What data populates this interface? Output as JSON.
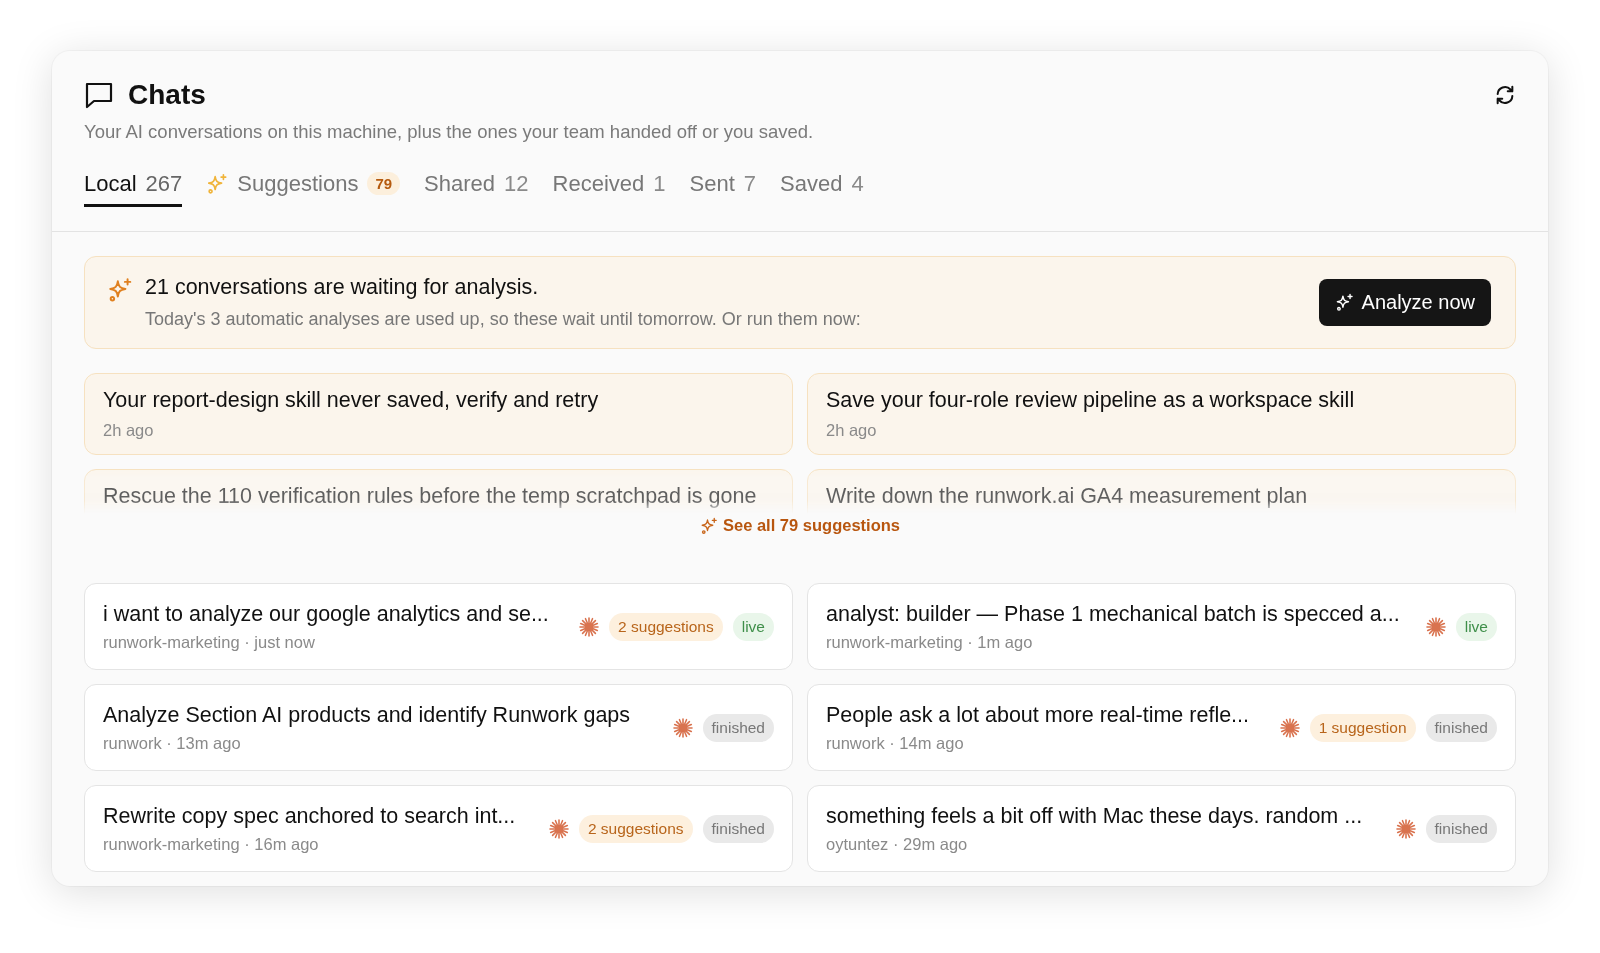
{
  "header": {
    "title": "Chats",
    "subtitle": "Your AI conversations on this machine, plus the ones your team handed off or you saved."
  },
  "tabs": [
    {
      "kind": "plain",
      "label": "Local",
      "count": "267",
      "selected": true
    },
    {
      "kind": "suggestions",
      "label": "Suggestions",
      "count": "79",
      "selected": false
    },
    {
      "kind": "plain",
      "label": "Shared",
      "count": "12",
      "selected": false
    },
    {
      "kind": "plain",
      "label": "Received",
      "count": "1",
      "selected": false
    },
    {
      "kind": "plain",
      "label": "Sent",
      "count": "7",
      "selected": false
    },
    {
      "kind": "plain",
      "label": "Saved",
      "count": "4",
      "selected": false
    }
  ],
  "banner": {
    "title": "21 conversations are waiting for analysis.",
    "text": "Today's 3 automatic analyses are used up, so these wait until tomorrow. Or run them now:",
    "button": "Analyze now"
  },
  "suggestions": [
    {
      "title": "Your report-design skill never saved, verify and retry",
      "time": "2h ago"
    },
    {
      "title": "Save your four-role review pipeline as a workspace skill",
      "time": "2h ago"
    },
    {
      "title": "Rescue the 110 verification rules before the temp scratchpad is gone"
    },
    {
      "title": "Write down the runwork.ai GA4 measurement plan"
    }
  ],
  "see_all": "See all 79 suggestions",
  "chats": [
    {
      "title": "i want to analyze our google analytics and se...",
      "meta": "runwork-marketing · just now",
      "suggestions": "2 suggestions",
      "status": "live"
    },
    {
      "title": "analyst: builder — Phase 1 mechanical batch is specced a...",
      "meta": "runwork-marketing · 1m ago",
      "status": "live"
    },
    {
      "title": "Analyze Section AI products and identify Runwork gaps",
      "meta": "runwork · 13m ago",
      "status": "finished"
    },
    {
      "title": "People ask a lot about more real-time refle...",
      "meta": "runwork · 14m ago",
      "suggestions": "1 suggestion",
      "status": "finished"
    },
    {
      "title": "Rewrite copy spec anchored to search int...",
      "meta": "runwork-marketing · 16m ago",
      "suggestions": "2 suggestions",
      "status": "finished"
    },
    {
      "title": "something feels a bit off with Mac these days. random ...",
      "meta": "oytuntez · 29m ago",
      "status": "finished"
    }
  ]
}
